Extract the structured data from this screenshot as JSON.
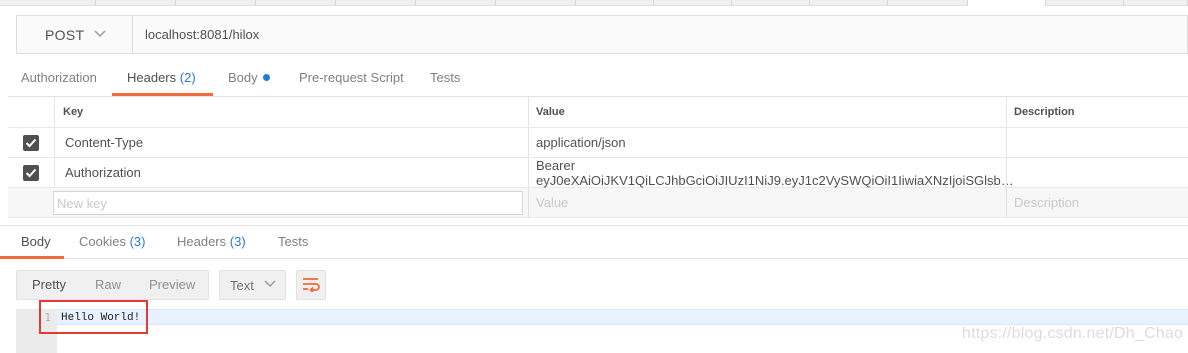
{
  "request": {
    "method": "POST",
    "url": "localhost:8081/hilox"
  },
  "request_tabs": [
    {
      "label": "Authorization",
      "count": ""
    },
    {
      "label": "Headers",
      "count": "(2)"
    },
    {
      "label": "Body",
      "count": ""
    },
    {
      "label": "Pre-request Script",
      "count": ""
    },
    {
      "label": "Tests",
      "count": ""
    }
  ],
  "headers_table": {
    "columns": {
      "key": "Key",
      "value": "Value",
      "description": "Description"
    },
    "rows": [
      {
        "checked": true,
        "key": "Content-Type",
        "value": "application/json",
        "description": ""
      },
      {
        "checked": true,
        "key": "Authorization",
        "value": "Bearer eyJ0eXAiOiJKV1QiLCJhbGciOiJIUzI1NiJ9.eyJ1c2VySWQiOiI1IiwiaXNzIjoiSGlsb…",
        "description": ""
      }
    ],
    "new_row": {
      "key_placeholder": "New key",
      "value_placeholder": "Value",
      "description_placeholder": "Description"
    }
  },
  "response_tabs": [
    {
      "label": "Body",
      "count": ""
    },
    {
      "label": "Cookies",
      "count": "(3)"
    },
    {
      "label": "Headers",
      "count": "(3)"
    },
    {
      "label": "Tests",
      "count": ""
    }
  ],
  "view_modes": {
    "pretty": "Pretty",
    "raw": "Raw",
    "preview": "Preview"
  },
  "format": "Text",
  "response_body": {
    "line_number": "1",
    "text": "Hello World!"
  },
  "watermark": "https://blog.csdn.net/Dh_Chao",
  "colors": {
    "accent": "#f26b3a",
    "link": "#2a7ad5",
    "highlight_box": "#e53935"
  }
}
